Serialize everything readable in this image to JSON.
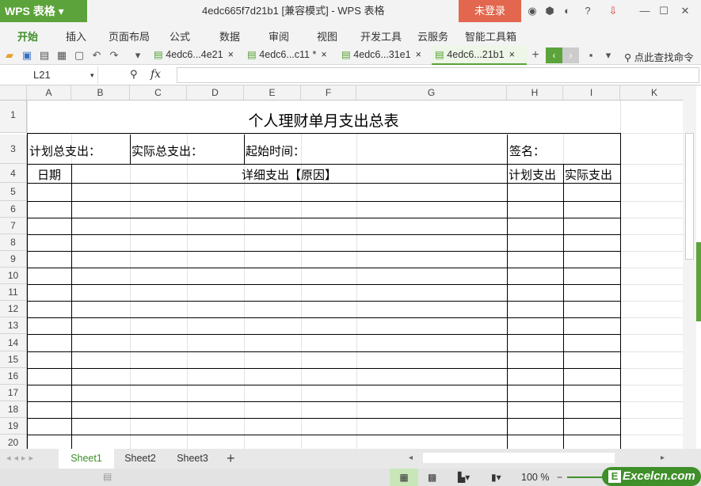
{
  "app": {
    "logo": "WPS 表格",
    "title": "4edc665f7d21b1 [兼容模式] - WPS 表格",
    "login": "未登录"
  },
  "menu": [
    "开始",
    "插入",
    "页面布局",
    "公式",
    "数据",
    "审阅",
    "视图",
    "开发工具",
    "云服务",
    "智能工具箱"
  ],
  "doc_tabs": [
    "4edc6...4e21",
    "4edc6...c11 *",
    "4edc6...31e1",
    "4edc6...21b1"
  ],
  "search_label": "点此查找命令",
  "name_box": "L21",
  "fx": "fx",
  "columns": [
    "A",
    "B",
    "C",
    "D",
    "E",
    "F",
    "G",
    "H",
    "I",
    "K"
  ],
  "rows": [
    "1",
    "3",
    "4",
    "5",
    "6",
    "7",
    "8",
    "9",
    "10",
    "11",
    "12",
    "13",
    "14",
    "15",
    "16",
    "17",
    "18",
    "19",
    "20"
  ],
  "sheet": {
    "title": "个人理财单月支出总表",
    "plan_total": "计划总支出：",
    "actual_total": "实际总支出：",
    "start_time": "起始时间：",
    "sign": "签名：",
    "date": "日期",
    "detail": "详细支出【原因】",
    "plan": "计划支出",
    "actual": "实际支出"
  },
  "sheet_tabs": [
    "Sheet1",
    "Sheet2",
    "Sheet3"
  ],
  "zoom": "100 %",
  "brand": "Excelcn.com",
  "colors": {
    "accent": "#5ba33a",
    "login": "#e2674e"
  }
}
